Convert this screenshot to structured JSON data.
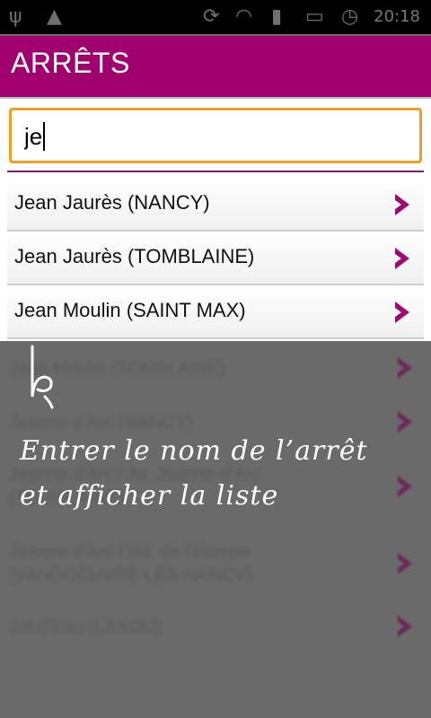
{
  "statusbar": {
    "time": "20:18"
  },
  "appbar": {
    "title": "ARRÊTS"
  },
  "search": {
    "value": "je",
    "placeholder": ""
  },
  "results": [
    {
      "label": "Jean Jaurès (NANCY)"
    },
    {
      "label": "Jean Jaurès (TOMBLAINE)"
    },
    {
      "label": "Jean Moulin (SAINT MAX)"
    }
  ],
  "blurred_results": [
    {
      "label": "Jean Moulin (TOMBLAINE)"
    },
    {
      "label": "Jeanne d'Arc (NANCY)"
    },
    {
      "label": "Jeanne d'Arc / Av. Jeanne d'Arc (TOMBLAINE)"
    },
    {
      "label": "Jeanne d'Arc / Bd. de l'Europe (VANDOEUVRE LES NANCY)"
    },
    {
      "label": "Jet d'Eau (LAXOU)"
    }
  ],
  "hint": {
    "line1": "Entrer le nom de l’arrêt",
    "line2": "et afficher la liste"
  },
  "colors": {
    "accent": "#a0006e",
    "focus_border": "#f0a020",
    "chevron": "#9c0a72"
  },
  "icons": [
    "usb-icon",
    "android-icon",
    "sync-icon",
    "wifi-icon",
    "signal-icon",
    "battery-icon",
    "alarm-icon",
    "chevron-right-icon",
    "pen-gesture-icon"
  ]
}
